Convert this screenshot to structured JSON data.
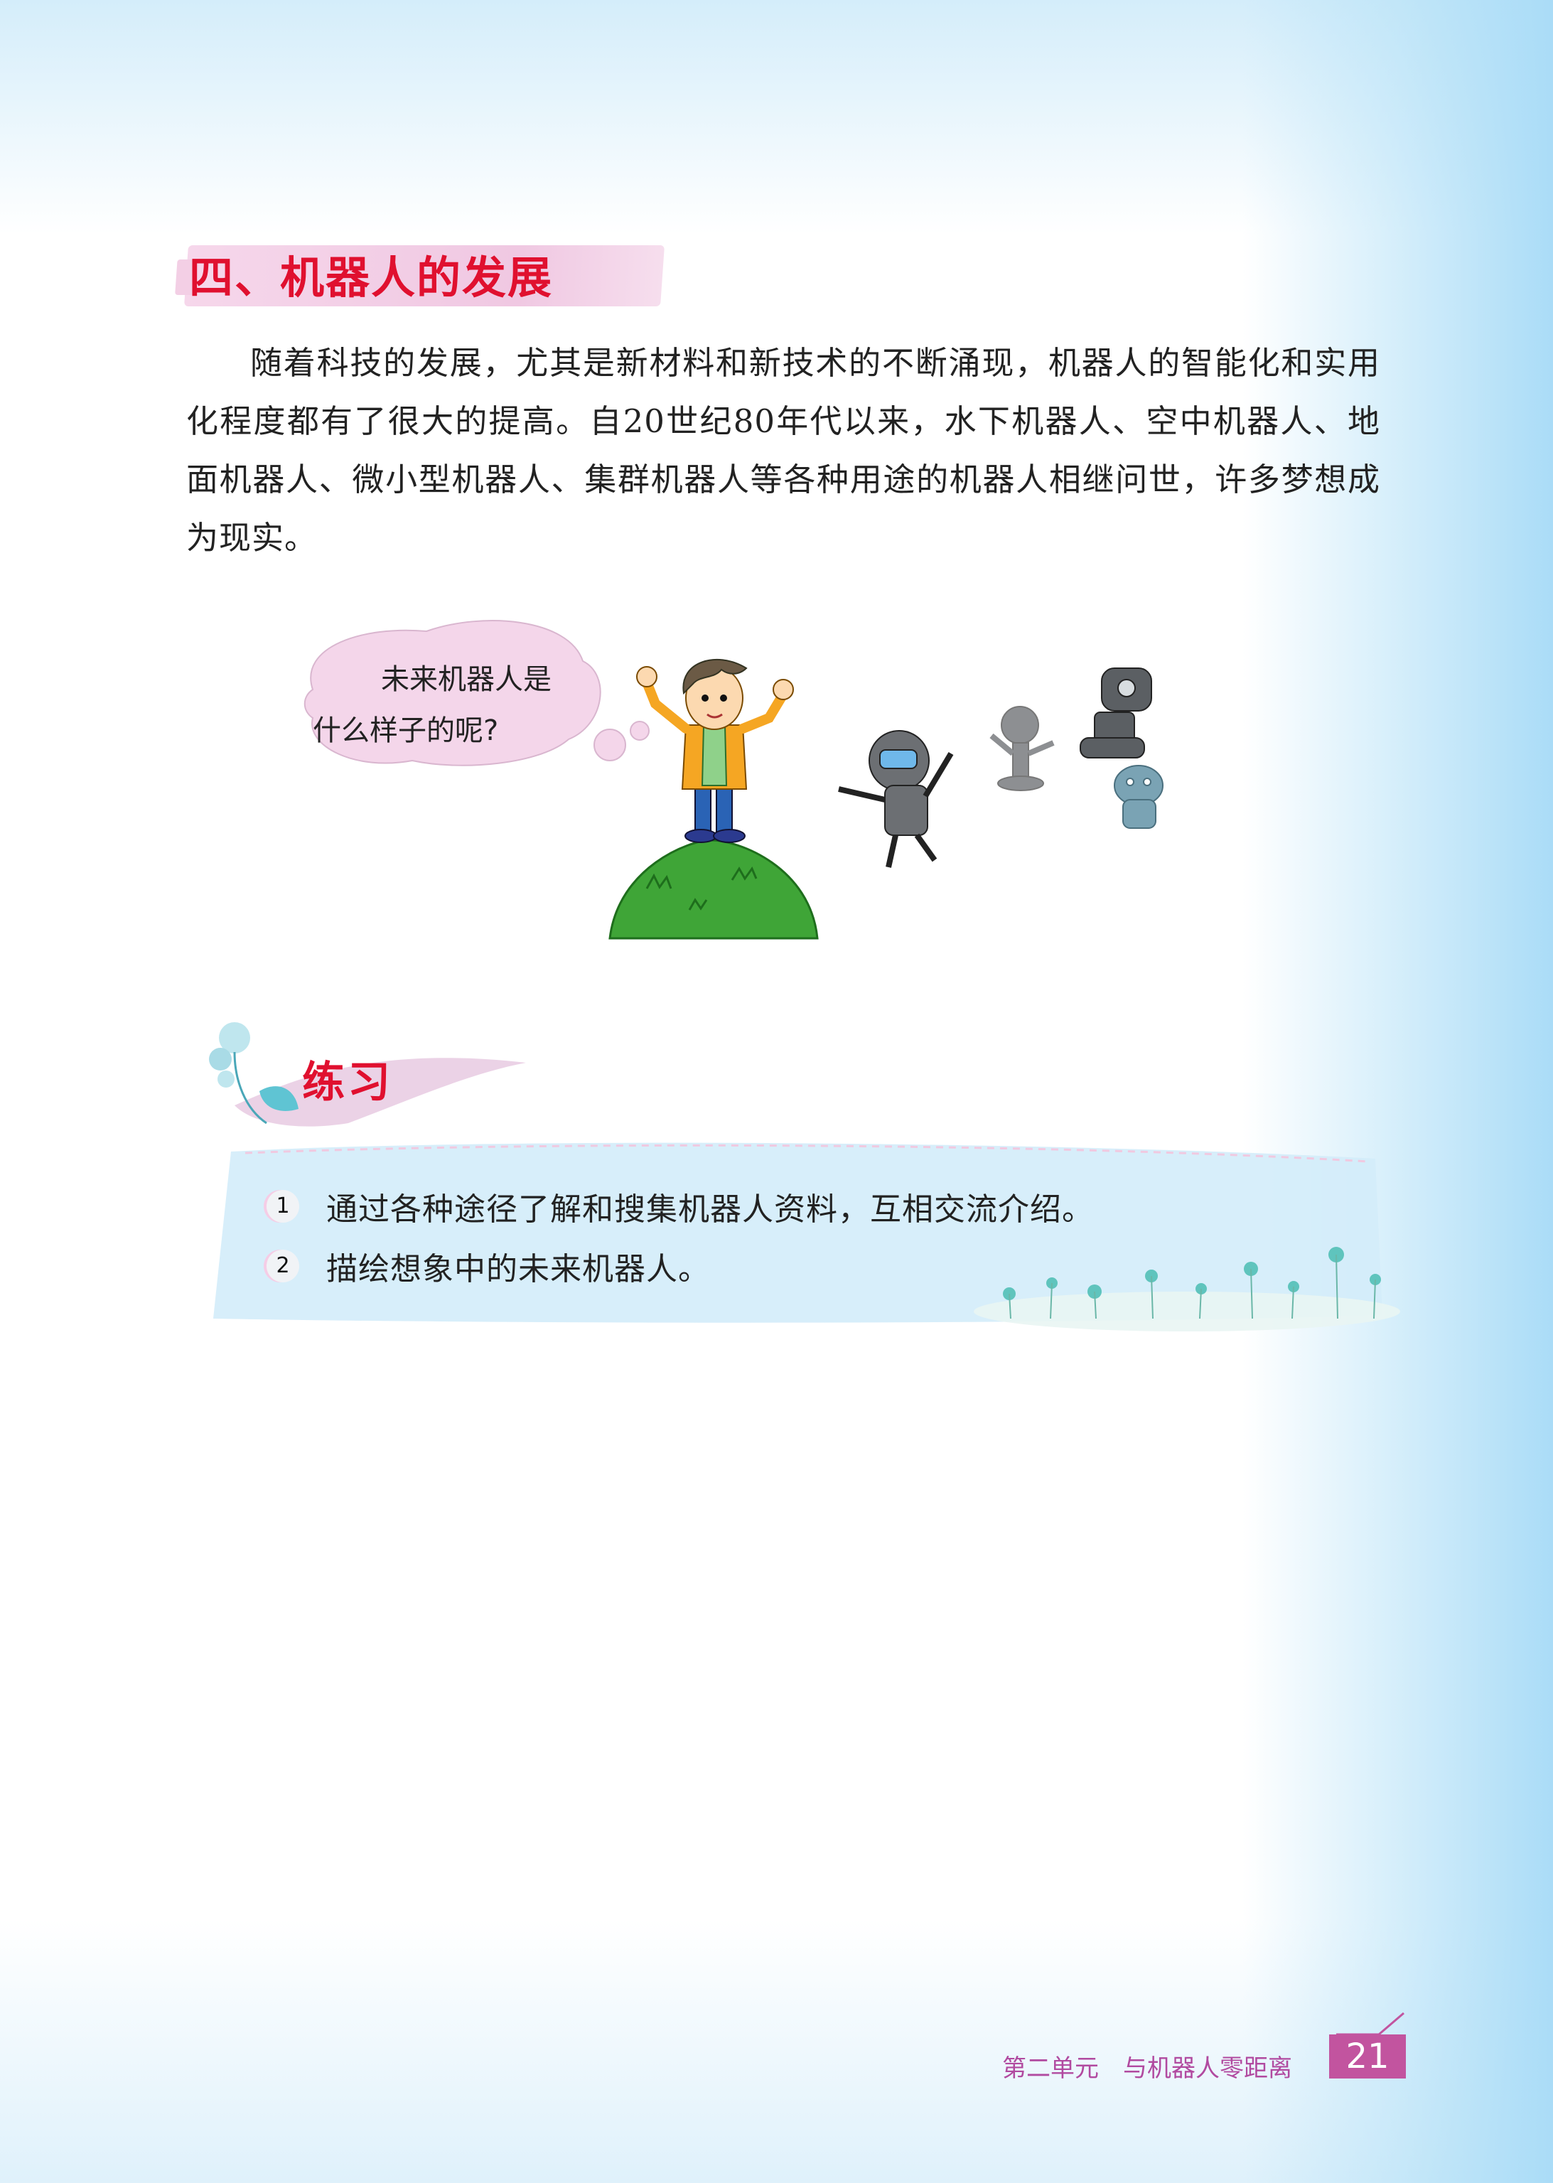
{
  "section": {
    "heading": "四、机器人的发展",
    "paragraph": "随着科技的发展，尤其是新材料和新技术的不断涌现，机器人的智能化和实用化程度都有了很大的提高。自20世纪80年代以来，水下机器人、空中机器人、地面机器人、微小型机器人、集群机器人等各种用途的机器人相继问世，许多梦想成为现实。"
  },
  "illustration": {
    "bubble_line1": "未来机器人是",
    "bubble_line2": "什么样子的呢?"
  },
  "practice": {
    "title": "练习",
    "items": [
      {
        "num": "1",
        "text": "通过各种途径了解和搜集机器人资料，互相交流介绍。"
      },
      {
        "num": "2",
        "text": "描绘想象中的未来机器人。"
      }
    ]
  },
  "footer": {
    "unit": "第二单元　与机器人零距离",
    "page": "21"
  },
  "colors": {
    "heading_red": "#e0102f",
    "accent_pink": "#c2549f",
    "panel_blue": "#d3ecfa"
  }
}
